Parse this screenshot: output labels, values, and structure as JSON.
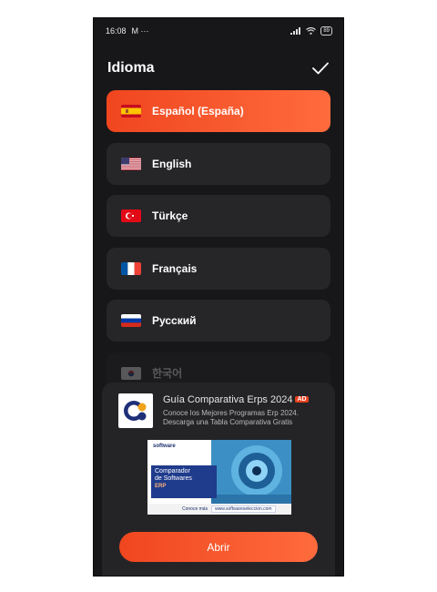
{
  "status_bar": {
    "time": "16:08",
    "notifications": "M ···",
    "battery": "89"
  },
  "header": {
    "title": "Idioma",
    "confirm_icon": "check-icon"
  },
  "languages": [
    {
      "label": "Español (España)",
      "flag": "flag-es-icon",
      "selected": true
    },
    {
      "label": "English",
      "flag": "flag-us-icon",
      "selected": false
    },
    {
      "label": "Türkçe",
      "flag": "flag-tr-icon",
      "selected": false
    },
    {
      "label": "Français",
      "flag": "flag-fr-icon",
      "selected": false
    },
    {
      "label": "Русский",
      "flag": "flag-ru-icon",
      "selected": false
    },
    {
      "label": "한국어",
      "flag": "flag-kr-icon",
      "selected": false
    }
  ],
  "ad": {
    "title": "Guía Comparativa Erps 2024",
    "badge": "AD",
    "description": "Conoce los Mejores Programas Erp 2024. Descarga una Tabla Comparativa Gratis",
    "banner": {
      "brand": "software",
      "headline_1": "Comparador",
      "headline_2": "de Softwares",
      "sub": "ERP",
      "cta": "Conoce más",
      "link": "www.softwareseleccion.com"
    },
    "button": "Abrir"
  },
  "colors": {
    "accent": "#f0461f",
    "background": "#17171a",
    "card": "#262629"
  }
}
